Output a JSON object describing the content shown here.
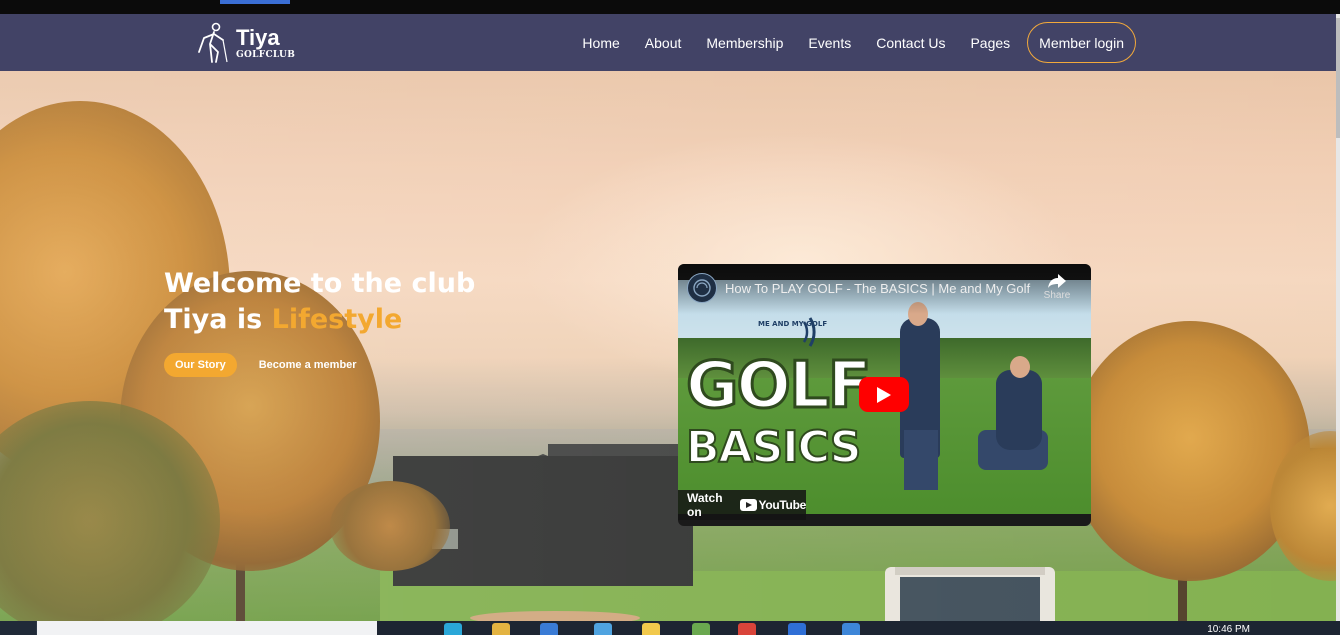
{
  "brand": {
    "name": "Tiya",
    "sub": "GOLFCLUB",
    "icon": "golfer-icon"
  },
  "nav": {
    "items": [
      {
        "label": "Home"
      },
      {
        "label": "About"
      },
      {
        "label": "Membership"
      },
      {
        "label": "Events"
      },
      {
        "label": "Contact Us"
      },
      {
        "label": "Pages"
      }
    ],
    "login_label": "Member login"
  },
  "hero": {
    "title_line1": "Welcome to the club",
    "title_line2_prefix": "Tiya is ",
    "title_line2_accent": "Lifestyle",
    "primary_button": "Our Story",
    "secondary_link": "Become a member"
  },
  "video": {
    "title": "How To PLAY GOLF - The BASICS | Me and My Golf",
    "share_label": "Share",
    "thumb_text_1": "GOLF",
    "thumb_text_2": "BASICS",
    "brand_text": "ME AND MY GOLF",
    "watch_on": "Watch on",
    "youtube_word": "YouTube"
  },
  "taskbar": {
    "time": "10:46 PM"
  },
  "colors": {
    "navbar": "#424366",
    "accent": "#f3a830",
    "login_border": "#f2a93b",
    "youtube_red": "#ff0000"
  }
}
